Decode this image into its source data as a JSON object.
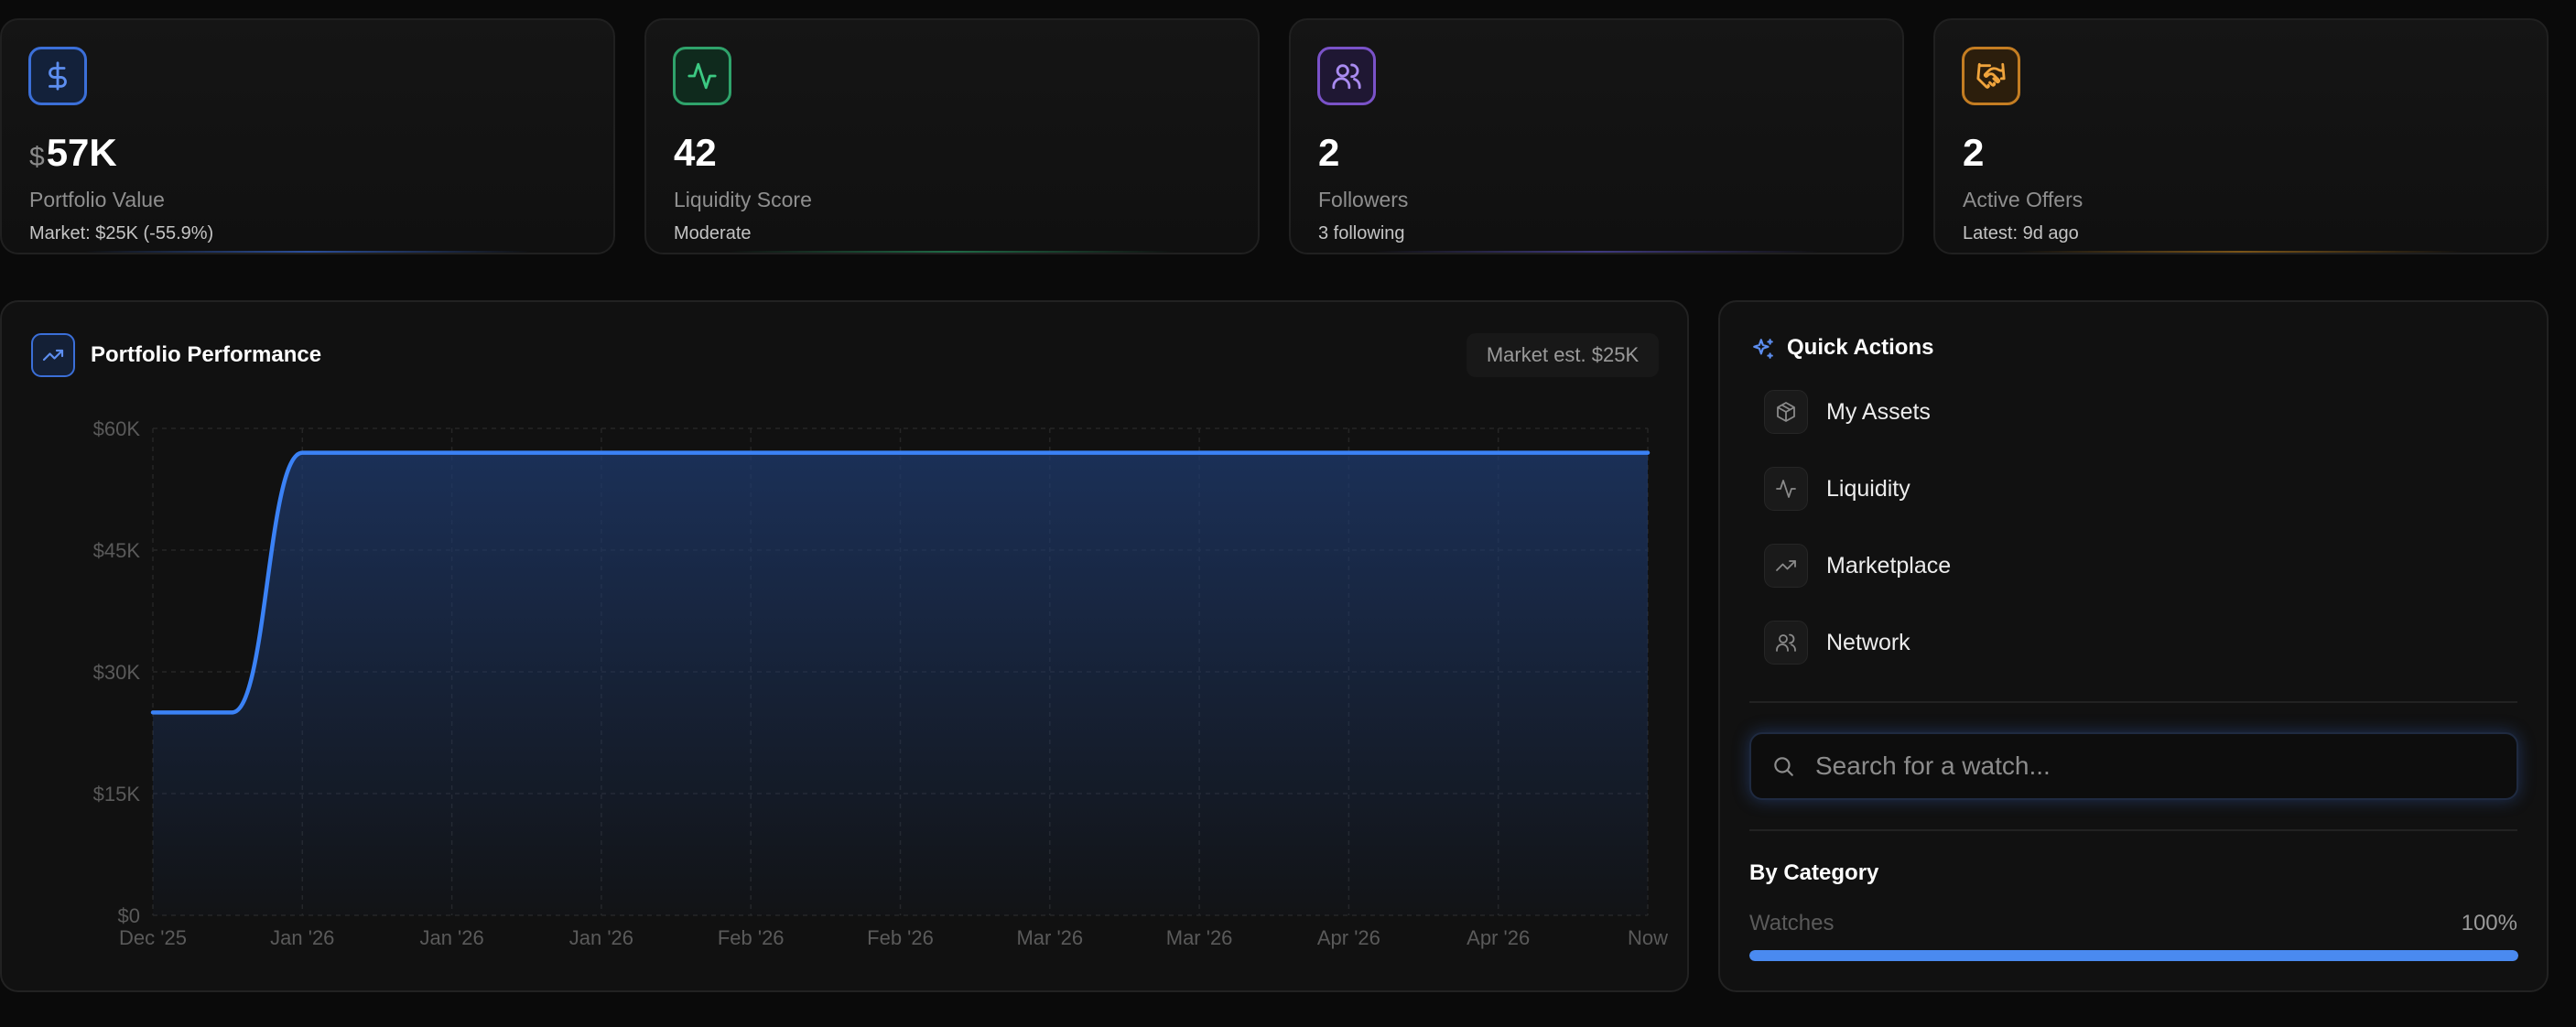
{
  "stats": [
    {
      "currency": "$",
      "value": "57K",
      "label": "Portfolio Value",
      "sub": "Market: $25K (-55.9%)",
      "icon": "dollar-icon",
      "color": "#3b6fd8"
    },
    {
      "currency": "",
      "value": "42",
      "label": "Liquidity Score",
      "sub": "Moderate",
      "icon": "activity-icon",
      "color": "#2fa36b"
    },
    {
      "currency": "",
      "value": "2",
      "label": "Followers",
      "sub": "3 following",
      "icon": "users-icon",
      "color": "#8a5cd8"
    },
    {
      "currency": "",
      "value": "2",
      "label": "Active Offers",
      "sub": "Latest: 9d ago",
      "icon": "handshake-icon",
      "color": "#d88a2a"
    }
  ],
  "performance": {
    "title": "Portfolio Performance",
    "badge": "Market est. $25K"
  },
  "chart_data": {
    "type": "area",
    "title": "",
    "xlabel": "",
    "ylabel": "",
    "x": [
      "Dec '25",
      "Jan '26",
      "Jan '26",
      "Jan '26",
      "Feb '26",
      "Feb '26",
      "Mar '26",
      "Mar '26",
      "Apr '26",
      "Apr '26",
      "Now"
    ],
    "yticks": [
      "$0",
      "$15K",
      "$30K",
      "$45K",
      "$60K"
    ],
    "ylim": [
      0,
      60000
    ],
    "grid": true,
    "series": [
      {
        "values": [
          25000,
          57000,
          57000,
          57000,
          57000,
          57000,
          57000,
          57000,
          57000,
          57000,
          57000
        ],
        "color": "#3b82f6"
      }
    ]
  },
  "quick_actions": {
    "title": "Quick Actions",
    "items": [
      {
        "label": "My Assets",
        "icon": "box-icon"
      },
      {
        "label": "Liquidity",
        "icon": "activity-icon"
      },
      {
        "label": "Marketplace",
        "icon": "trending-up-icon"
      },
      {
        "label": "Network",
        "icon": "users-icon"
      }
    ],
    "search_placeholder": "Search for a watch..."
  },
  "categories": {
    "title": "By Category",
    "items": [
      {
        "name": "Watches",
        "percent_label": "100%",
        "fraction": 1.0
      }
    ]
  }
}
